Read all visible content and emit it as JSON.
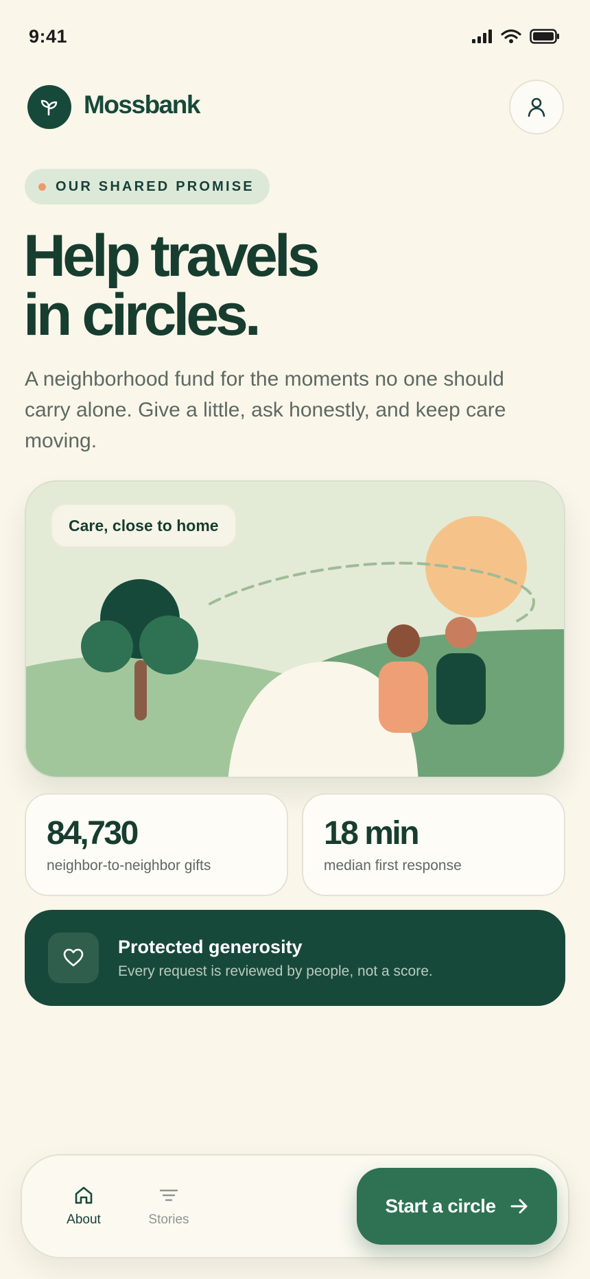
{
  "status_bar": {
    "time": "9:41"
  },
  "header": {
    "brand": "Mossbank"
  },
  "hero": {
    "eyebrow": "OUR SHARED PROMISE",
    "title_line1": "Help travels",
    "title_line2": "in circles.",
    "subtitle": "A neighborhood fund for the moments no one should carry alone. Give a little, ask honestly, and keep care moving."
  },
  "illustration": {
    "chip": "Care, close to home"
  },
  "stats": [
    {
      "value": "84,730",
      "label": "neighbor-to-neighbor gifts"
    },
    {
      "value": "18 min",
      "label": "median first response"
    }
  ],
  "protected": {
    "title": "Protected generosity",
    "subtitle": "Every request is reviewed by people, not a score."
  },
  "bottom_nav": {
    "items": [
      {
        "label": "About",
        "icon": "home-icon",
        "active": true
      },
      {
        "label": "Stories",
        "icon": "stories-icon",
        "active": false
      }
    ],
    "cta": "Start a circle"
  },
  "colors": {
    "background": "#faf6ea",
    "primary": "#17493a",
    "accent": "#2e7253",
    "peach": "#ee9a6e"
  }
}
